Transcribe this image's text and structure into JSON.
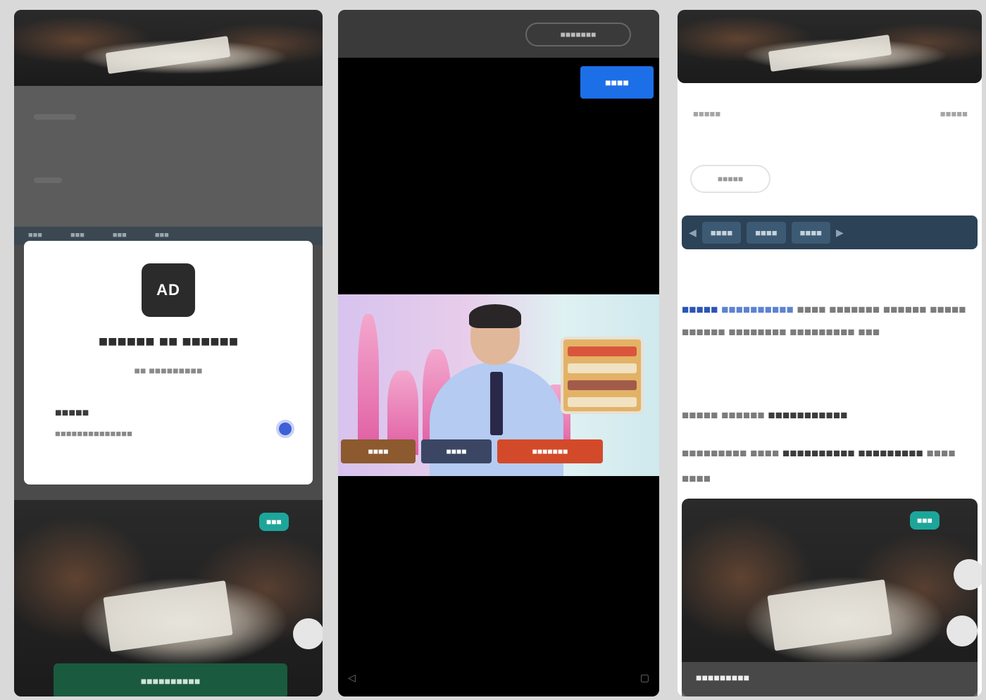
{
  "panel1": {
    "nav_items": [
      "■■■",
      "■■■",
      "■■■",
      "■■■"
    ],
    "dialog": {
      "app_icon_text": "AD",
      "title": "■■■■■■ ■■ ■■■■■■",
      "subtitle": "■■ ■■■■■■■■■",
      "account_name": "■■■■■",
      "account_email": "■■■■■■■■■■■■■■"
    },
    "photo_badge": "■■■",
    "bottom_button": "■■■■■■■■■■"
  },
  "panel2": {
    "top_pill": "■■■■■■■",
    "blue_button": "■■■■",
    "video": {
      "board_left": "■■■■",
      "board_mid": "■■■■",
      "board_right": "■■■■■■■"
    },
    "corner_left": "◁",
    "corner_right": "▢"
  },
  "panel3": {
    "meta_left": "■■■■■",
    "meta_right": "■■■■■",
    "tag_chip": "■■■■■",
    "categories": [
      "■■■■",
      "■■■■",
      "■■■■"
    ],
    "article": {
      "highlight": "■■■■■",
      "link": "■■■■■■■■■■",
      "body": "■■■■ ■■■■■■■ ■■■■■■ ■■■■■ ■■■■■■ ■■■■■■■■ ■■■■■■■■■ ■■■"
    },
    "line2_plain": "■■■■■ ■■■■■■",
    "line2_bold": "■■■■■■■■■■■",
    "line3_plain": "■■■■■■■■■ ■■■■",
    "line3_bold": "■■■■■■■■■■ ■■■■■■■■■",
    "line3_tail": "■■■■ ■■■■",
    "photo_badge": "■■■",
    "bottom_caption": "■■■■■■■■■"
  },
  "colors": {
    "accent_blue": "#1d6fe8",
    "teal_badge": "#1ea59a",
    "green_button": "#1a5a3f",
    "category_bar": "#2c4256"
  }
}
